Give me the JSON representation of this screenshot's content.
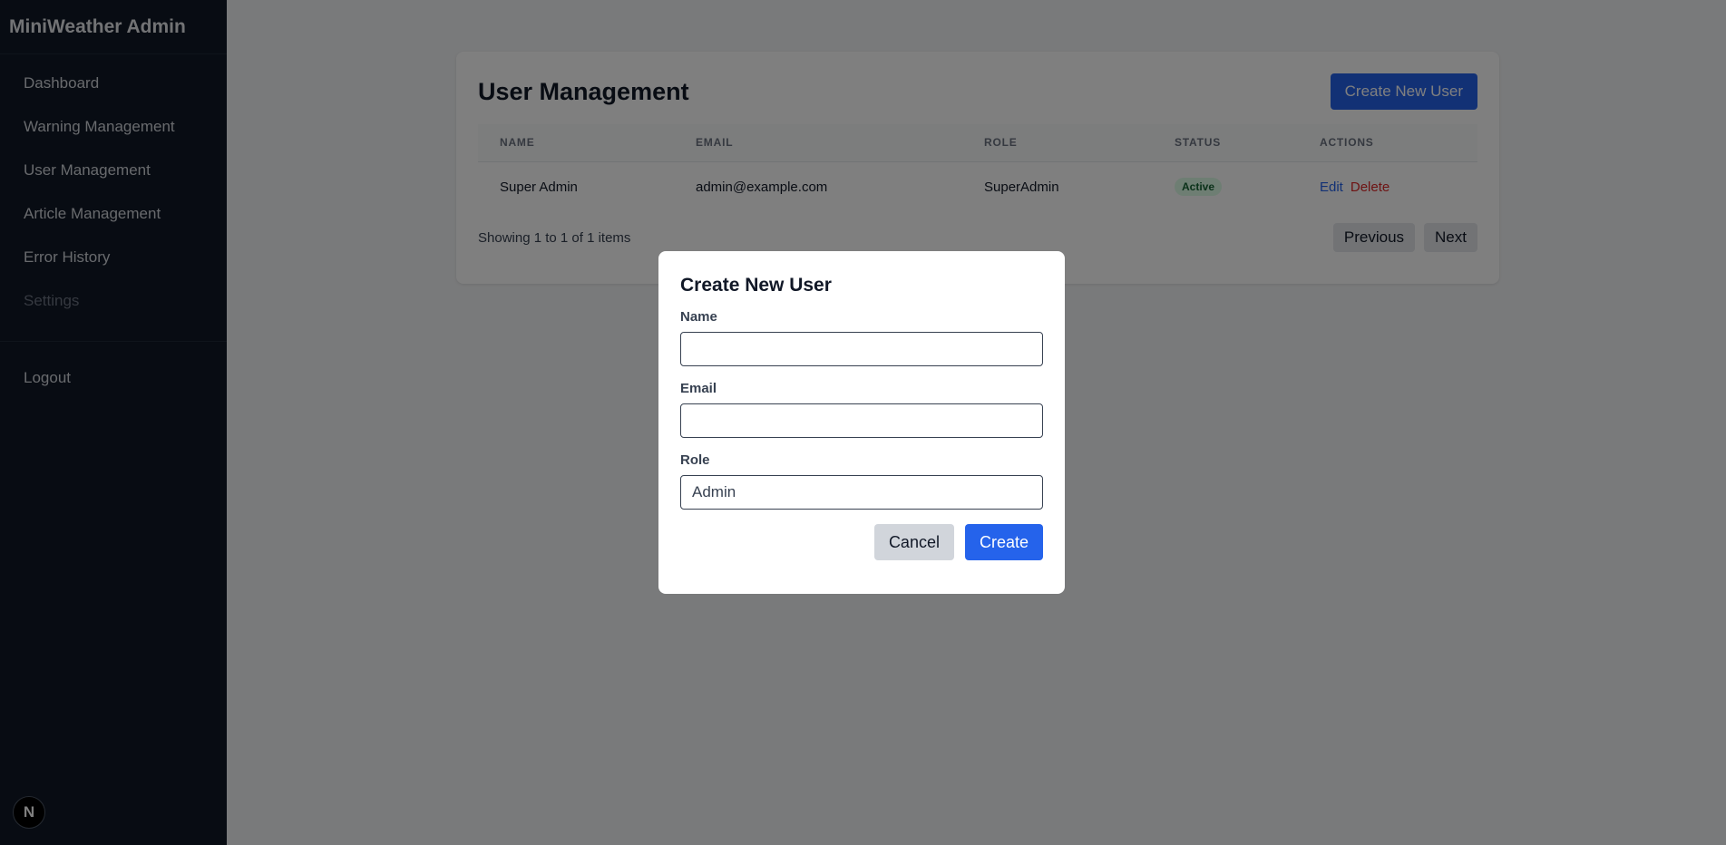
{
  "sidebar": {
    "brand": "MiniWeather Admin",
    "items": [
      {
        "label": "Dashboard"
      },
      {
        "label": "Warning Management"
      },
      {
        "label": "User Management"
      },
      {
        "label": "Article Management"
      },
      {
        "label": "Error History"
      },
      {
        "label": "Settings"
      }
    ],
    "logout": "Logout",
    "badge_letter": "N"
  },
  "page": {
    "title": "User Management",
    "create_button": "Create New User",
    "columns": [
      "NAME",
      "EMAIL",
      "ROLE",
      "STATUS",
      "ACTIONS"
    ],
    "rows": [
      {
        "name": "Super Admin",
        "email": "admin@example.com",
        "role": "SuperAdmin",
        "status": "Active",
        "edit": "Edit",
        "delete": "Delete"
      }
    ],
    "showing": "Showing 1 to 1 of 1 items",
    "previous": "Previous",
    "next": "Next"
  },
  "modal": {
    "title": "Create New User",
    "name_label": "Name",
    "name_value": "",
    "email_label": "Email",
    "email_value": "",
    "role_label": "Role",
    "role_value": "Admin",
    "cancel": "Cancel",
    "create": "Create"
  },
  "colors": {
    "sidebar_bg": "#111827",
    "accent": "#2563eb",
    "danger": "#dc2626",
    "success_bg": "#dcfce7",
    "success_text": "#166534"
  }
}
